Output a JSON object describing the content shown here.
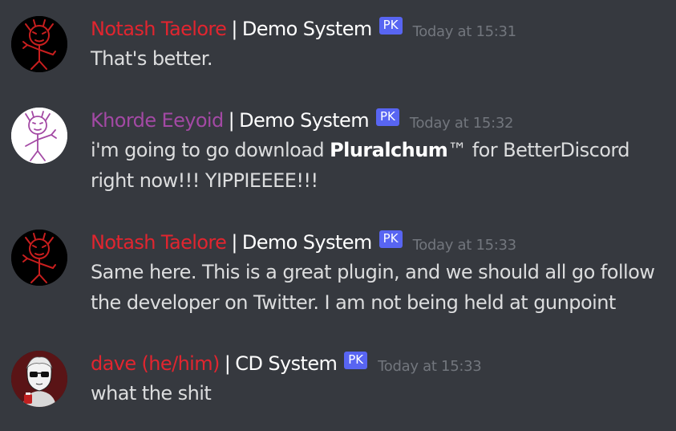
{
  "colors": {
    "background": "#36393f",
    "notash": "#e1252f",
    "khorde": "#a349a4",
    "dave": "#e1252f",
    "pk_badge": "#5865f2",
    "timestamp": "#72767d",
    "text": "#dcddde"
  },
  "messages": [
    {
      "avatar_icon": "red-stick-figure-avatar-icon",
      "author": "Notash Taelore",
      "separator": "|",
      "system": "Demo System",
      "badge": "PK",
      "timestamp": "Today at 15:31",
      "lines": [
        "That's better."
      ]
    },
    {
      "avatar_icon": "purple-stick-figure-avatar-icon",
      "author": "Khorde Eeyoid",
      "separator": "|",
      "system": "Demo System",
      "badge": "PK",
      "timestamp": "Today at 15:32",
      "line1_before": "i'm going to go download ",
      "line1_bold": "Pluralchum",
      "line1_after": "™ for BetterDiscord",
      "line2": "right now!!! YIPPIEEEE!!!"
    },
    {
      "avatar_icon": "red-stick-figure-avatar-icon",
      "author": "Notash Taelore",
      "separator": "|",
      "system": "Demo System",
      "badge": "PK",
      "timestamp": "Today at 15:33",
      "lines": [
        "Same here. This is a great plugin, and we should all go follow",
        "the developer on Twitter. I am not being held at gunpoint"
      ]
    },
    {
      "avatar_icon": "dave-sunglasses-avatar-icon",
      "author": "dave (he/him)",
      "separator": "|",
      "system": "CD System",
      "badge": "PK",
      "timestamp": "Today at 15:33",
      "lines": [
        "what the shit"
      ]
    }
  ]
}
